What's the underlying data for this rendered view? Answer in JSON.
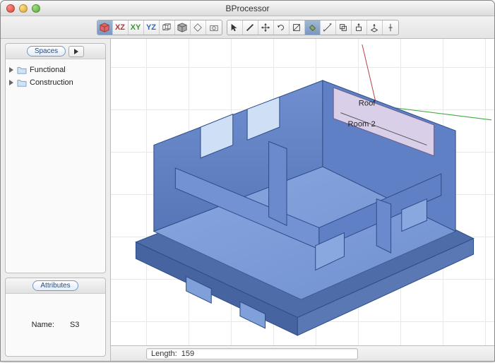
{
  "window": {
    "title": "BProcessor"
  },
  "toolbar": {
    "view_group": [
      {
        "name": "3d-view",
        "label": "3D",
        "active": true
      },
      {
        "name": "xz-view",
        "label": "XZ"
      },
      {
        "name": "xy-view",
        "label": "XY"
      },
      {
        "name": "yz-view",
        "label": "YZ"
      },
      {
        "name": "cube-wire-view",
        "label": ""
      },
      {
        "name": "cube-solid-view",
        "label": ""
      },
      {
        "name": "perspective-view",
        "label": ""
      },
      {
        "name": "camera-view",
        "label": ""
      }
    ],
    "tool_group": [
      {
        "name": "select-tool"
      },
      {
        "name": "line-tool"
      },
      {
        "name": "move-tool"
      },
      {
        "name": "rotate-tool"
      },
      {
        "name": "scale-tool"
      },
      {
        "name": "paint-tool",
        "active": true
      },
      {
        "name": "measure-tool"
      },
      {
        "name": "offset-tool"
      },
      {
        "name": "pushpull-tool"
      },
      {
        "name": "extrude-tool"
      },
      {
        "name": "eraser-tool"
      }
    ]
  },
  "sidebar": {
    "spaces": {
      "tab_label": "Spaces",
      "items": [
        {
          "label": "Functional"
        },
        {
          "label": "Construction"
        }
      ]
    },
    "attributes": {
      "tab_label": "Attributes",
      "name_label": "Name:",
      "name_value": "S3"
    }
  },
  "viewport": {
    "annotations": {
      "roof_label": "Roof",
      "room_label": "Room 2"
    }
  },
  "status": {
    "length_label": "Length:",
    "length_value": "159"
  }
}
